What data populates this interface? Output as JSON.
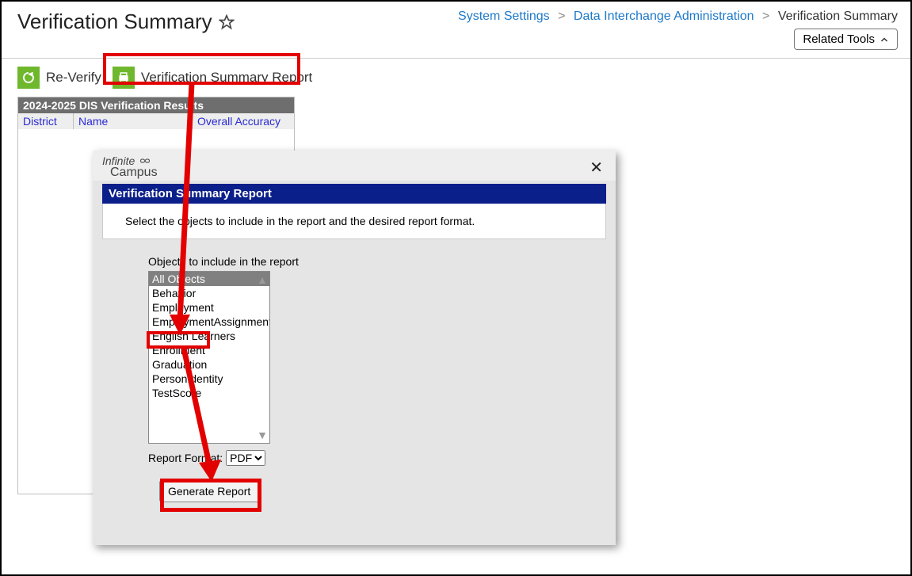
{
  "header": {
    "title": "Verification Summary",
    "breadcrumb": {
      "item1": "System Settings",
      "item2": "Data Interchange Administration",
      "item3": "Verification Summary"
    },
    "related_tools_label": "Related Tools"
  },
  "toolbar": {
    "reverify_label": "Re-Verify",
    "report_label": "Verification Summary Report"
  },
  "results": {
    "title": "2024-2025 DIS Verification Results",
    "col_district": "District",
    "col_name": "Name",
    "col_accuracy": "Overall Accuracy"
  },
  "modal": {
    "logo_top": "Infinite",
    "logo_bottom": "Campus",
    "title": "Verification Summary Report",
    "description": "Select the objects to include in the report and the desired report format.",
    "objects_label": "Objects to include in the report",
    "options": [
      "All Objects",
      "Behavior",
      "Employment",
      "EmploymentAssignment",
      "English Learners",
      "Enrollment",
      "Graduation",
      "PersonIdentity",
      "TestScore"
    ],
    "selected_index": 0,
    "format_label": "Report Format:",
    "format_value": "PDF",
    "generate_label": "Generate Report"
  }
}
